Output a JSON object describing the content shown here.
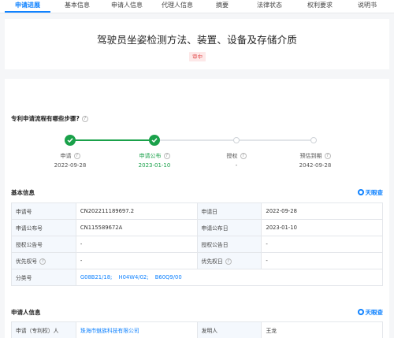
{
  "tabs": [
    "申请进展",
    "基本信息",
    "申请人信息",
    "代理人信息",
    "摘要",
    "法律状态",
    "权利要求",
    "说明书"
  ],
  "title": "驾驶员坐姿检测方法、装置、设备及存储介质",
  "status_badge": "审中",
  "process_question": "专利申请流程有哪些步骤?",
  "steps": [
    {
      "label": "申请",
      "date": "2022-09-28"
    },
    {
      "label": "申请公布",
      "date": "2023-01-10"
    },
    {
      "label": "授权",
      "date": "-"
    },
    {
      "label": "预估到期",
      "date": "2042-09-28"
    }
  ],
  "brand_name": "天眼查",
  "basic_info": {
    "heading": "基本信息",
    "app_no_label": "申请号",
    "app_no": "CN202211189697.2",
    "app_date_label": "申请日",
    "app_date": "2022-09-28",
    "pub_no_label": "申请公布号",
    "pub_no": "CN115589672A",
    "pub_date_label": "申请公布日",
    "pub_date": "2023-01-10",
    "grant_no_label": "授权公告号",
    "grant_no": "-",
    "grant_date_label": "授权公告日",
    "grant_date": "-",
    "priority_no_label": "优先权号",
    "priority_no": "-",
    "priority_date_label": "优先权日",
    "priority_date": "-",
    "class_label": "分类号",
    "classes": [
      "G08B21/18;",
      "H04W4/02;",
      "B60Q9/00"
    ]
  },
  "applicant_info": {
    "heading": "申请人信息",
    "applicant_label": "申请（专利权）人",
    "applicant": "珠海市魅族科技有限公司",
    "inventor_label": "发明人",
    "inventor": "王龙"
  }
}
